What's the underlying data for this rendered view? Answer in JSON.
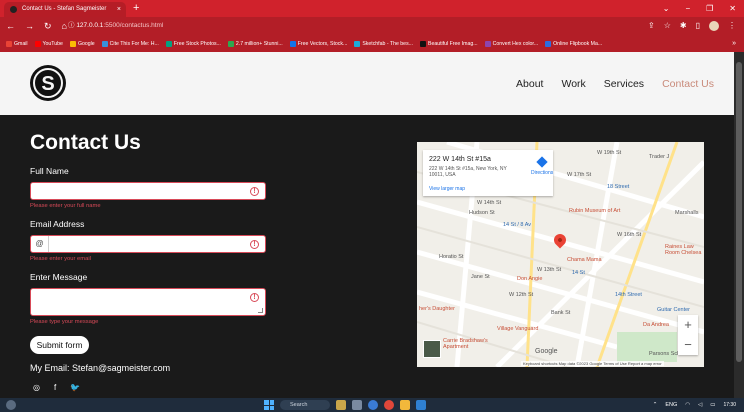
{
  "browser": {
    "tab_title": "Contact Us - Stefan Sagmeister",
    "tab_close": "×",
    "new_tab": "+",
    "window_controls": [
      "⌄",
      "−",
      "❐",
      "✕"
    ],
    "url_host": "127.0.0.1",
    "url_path": ":5500/contactus.html",
    "bookmarks": [
      {
        "label": "Gmail",
        "color": "#ea4335"
      },
      {
        "label": "YouTube",
        "color": "#ff0000"
      },
      {
        "label": "Google",
        "color": "#fbbc05"
      },
      {
        "label": "Cite This For Me: H...",
        "color": "#3a8fd9"
      },
      {
        "label": "Free Stock Photos...",
        "color": "#05a081"
      },
      {
        "label": "2.7 million+ Stunni...",
        "color": "#2fa84f"
      },
      {
        "label": "Free Vectors, Stock...",
        "color": "#1273eb"
      },
      {
        "label": "Sketchfab - The bes...",
        "color": "#1caad9"
      },
      {
        "label": "Beautiful Free Imag...",
        "color": "#111111"
      },
      {
        "label": "Convert Hex color...",
        "color": "#8e44ad"
      },
      {
        "label": "Online Flipbook Ma...",
        "color": "#2d6cdf"
      }
    ]
  },
  "nav": {
    "logo_letter": "S",
    "items": [
      "About",
      "Work",
      "Services",
      "Contact Us"
    ],
    "active": "Contact Us"
  },
  "form": {
    "title": "Contact Us",
    "full_name_label": "Full Name",
    "full_name_error": "Please enter your full name",
    "email_label": "Email Address",
    "email_prefix": "@",
    "email_error": "Please enter your email",
    "message_label": "Enter Message",
    "message_error": "Please type your message",
    "submit_label": "Submit form",
    "my_email": "My Email: Stefan@sagmeister.com",
    "socials": [
      "◎",
      "f",
      "🐦"
    ]
  },
  "map": {
    "card_title": "222 W 14th St #15a",
    "card_address": "222 W 14th St #15a, New York, NY 10011, USA",
    "directions": "Directions",
    "larger_map": "View larger map",
    "labels": {
      "trader_joes": "Trader J",
      "street_18": "18 Street",
      "rubin": "Rubin Museum of Art",
      "marshalls": "Marshalls",
      "subway_14": "14 St / 8 Av",
      "raines": "Raines Law Room Chelsea",
      "chama": "Chama Mama",
      "st_14": "14 St",
      "don_angie": "Don Angie",
      "st_14th": "14th Street",
      "guitar": "Guitar Center",
      "daughter": "her's Daughter",
      "da_andrea": "Da Andrea",
      "vanguard": "Village Vanguard",
      "bradshaw": "Carrie Bradshaw's Apartment",
      "parsons": "Parsons School o",
      "w_14th": "W 14th St",
      "w_13th": "W 13th St",
      "w_12th": "W 12th St",
      "jane": "Jane St",
      "horatio": "Horatio St",
      "hudson": "Hudson St",
      "bank": "Bank St",
      "w_16th": "W 16th St",
      "w_17th": "W 17th St",
      "w_19th": "W 19th St"
    },
    "zoom_in": "+",
    "zoom_out": "−",
    "google": "Google",
    "footer": "Keyboard shortcuts   Map data ©2023 Google   Terms of Use   Report a map error"
  },
  "taskbar": {
    "search": "Search",
    "lang": "ENG",
    "time": "17:30"
  }
}
